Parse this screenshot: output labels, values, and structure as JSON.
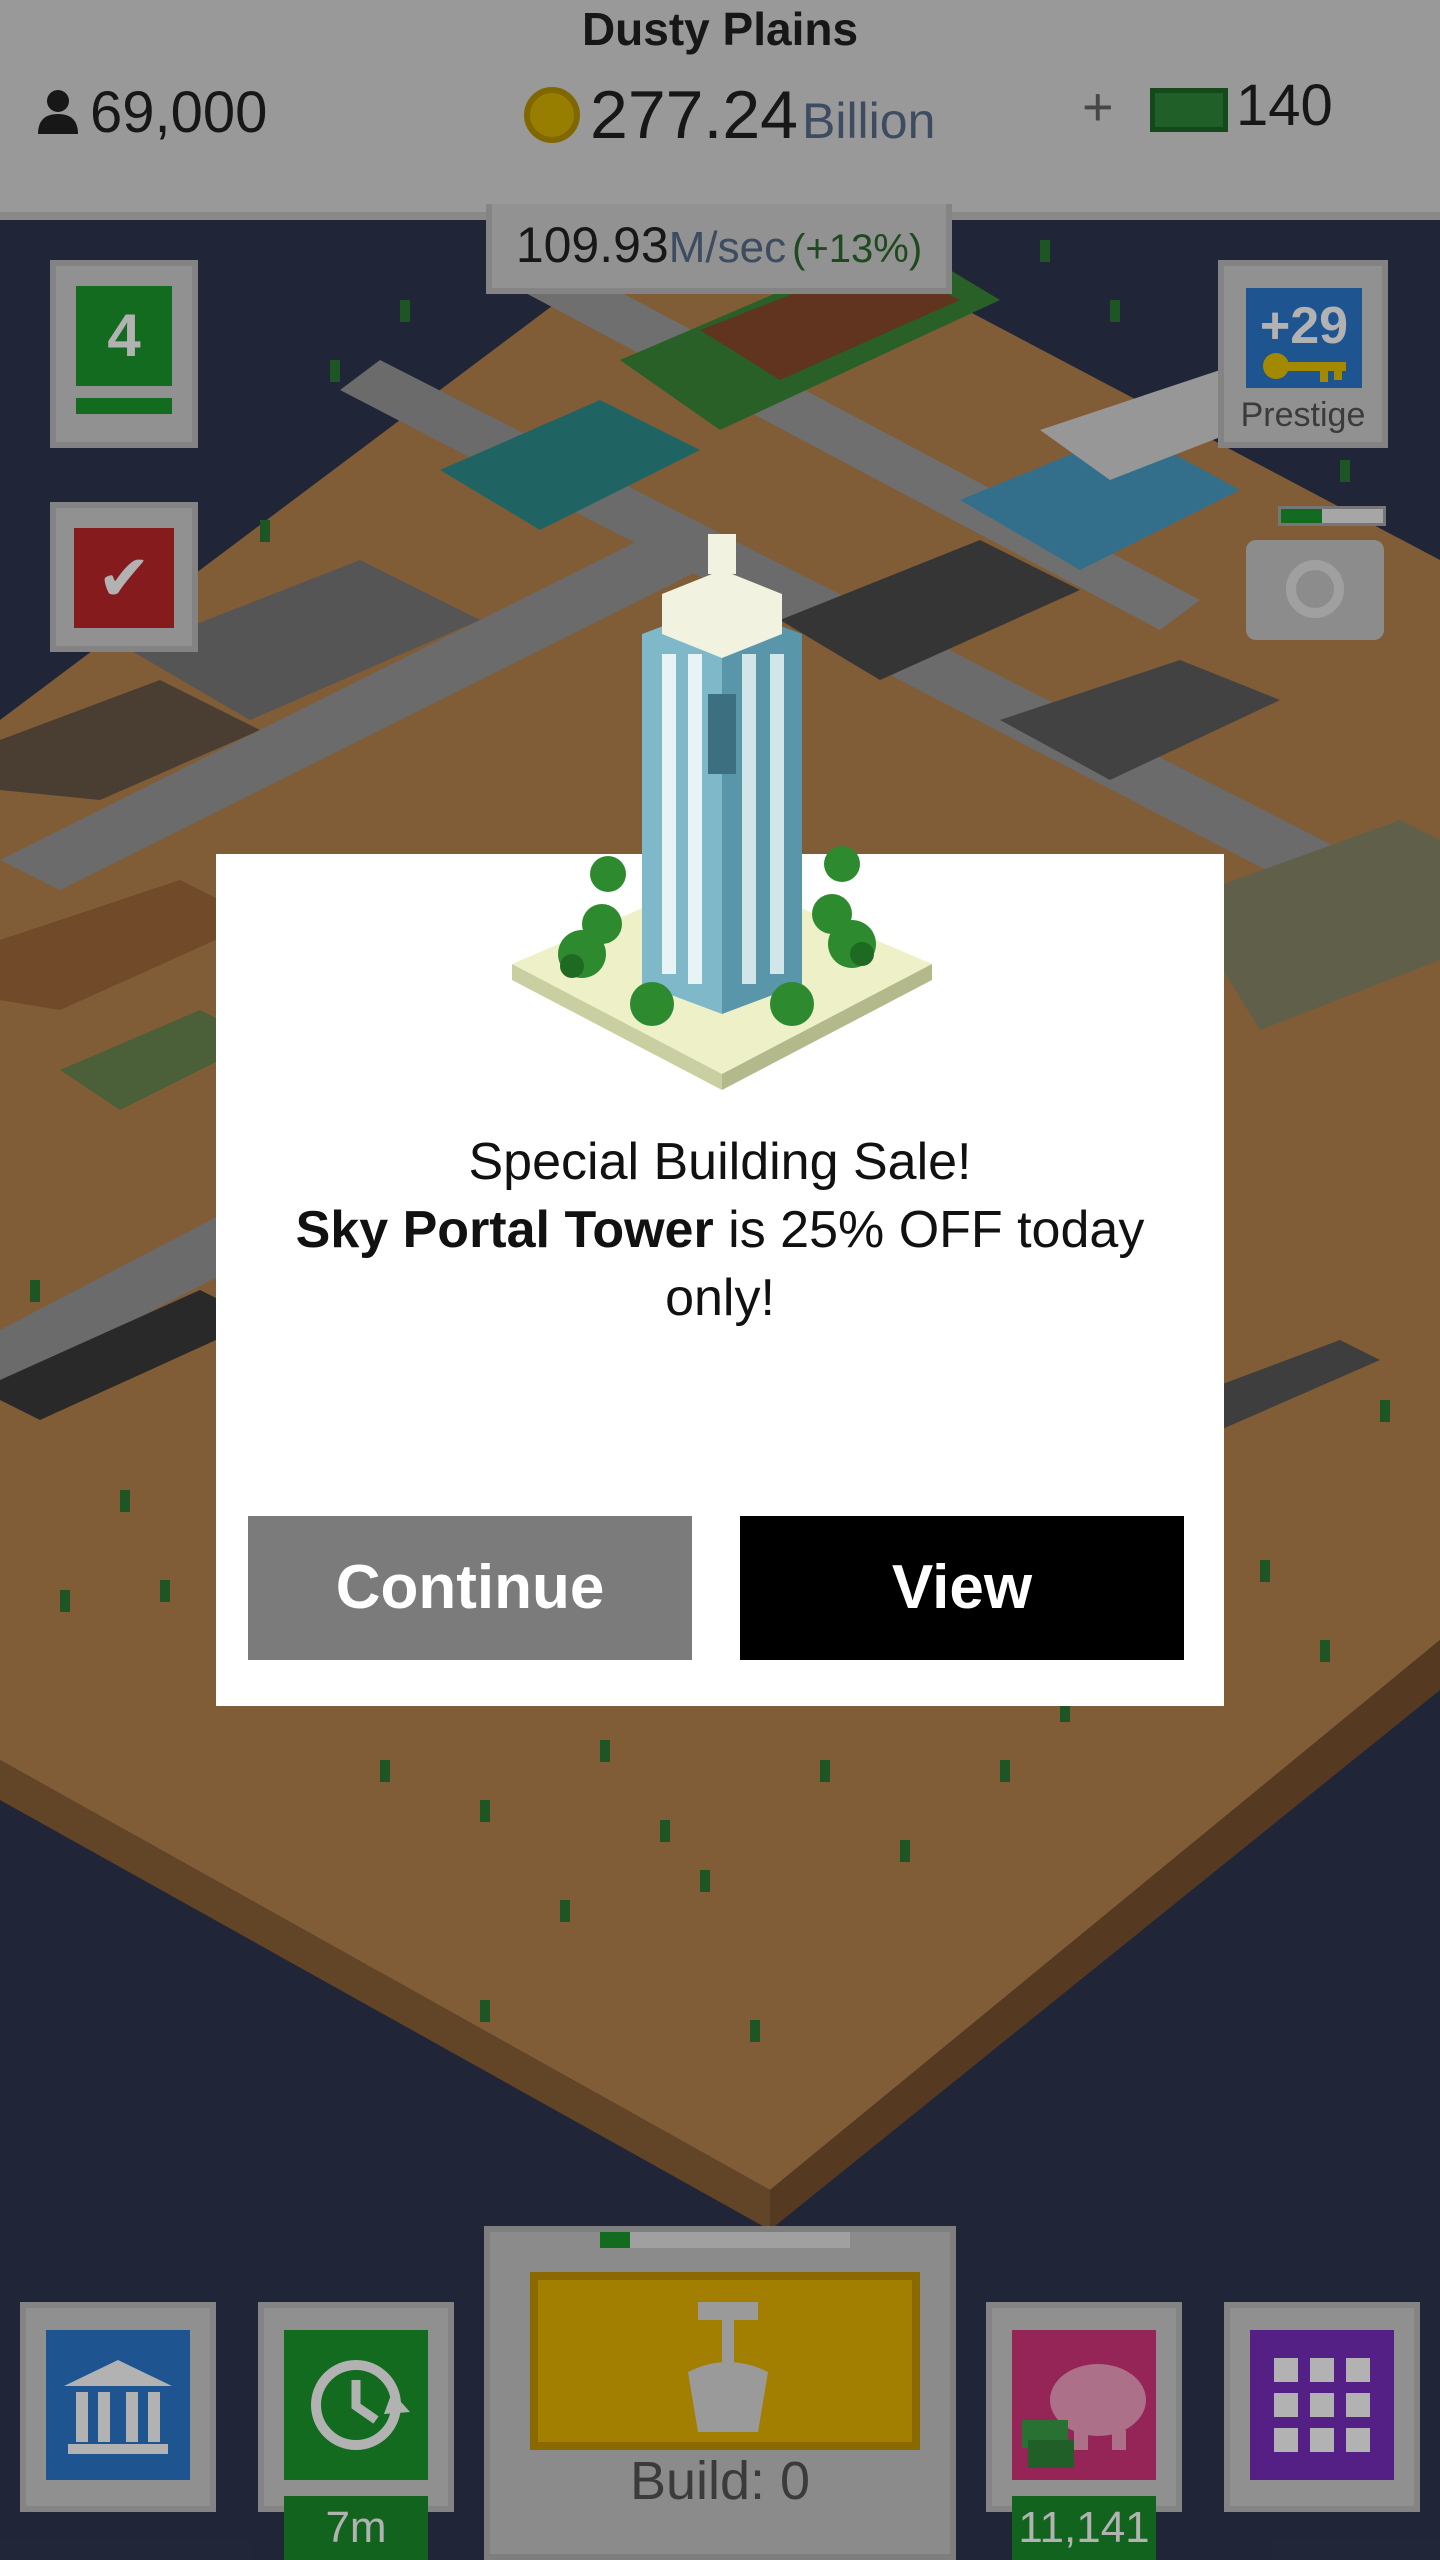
{
  "hud": {
    "city_name": "Dusty Plains",
    "population": "69,000",
    "money_value": "277.24",
    "money_unit": "Billion",
    "plus": "+",
    "bucks": "140",
    "rate_value": "109.93",
    "rate_unit": "M/sec",
    "rate_bonus": "(+13%)"
  },
  "side": {
    "level": "4",
    "tasks_icon": "check-icon",
    "prestige_count": "+29",
    "prestige_label": "Prestige",
    "camera_charge": 0.4
  },
  "bottom": {
    "bank_icon": "bank-icon",
    "timer_icon": "clock-refresh-icon",
    "timer_badge": "7m",
    "build_label": "Build: 0",
    "build_progress": 0.12,
    "piggy_icon": "piggy-bank-icon",
    "piggy_badge": "11,141",
    "menu_icon": "grid-menu-icon"
  },
  "dialog": {
    "line1": "Special Building Sale!",
    "building_name": "Sky Portal Tower",
    "line2_rest": " is 25% OFF today only!",
    "continue_label": "Continue",
    "view_label": "View"
  },
  "colors": {
    "dialog_bg": "#ffffff",
    "continue_bg": "#7b7b7b",
    "view_bg": "#000000",
    "water": "#2f3650",
    "sand": "#b8854f",
    "green_accent": "#1a9a2b"
  }
}
